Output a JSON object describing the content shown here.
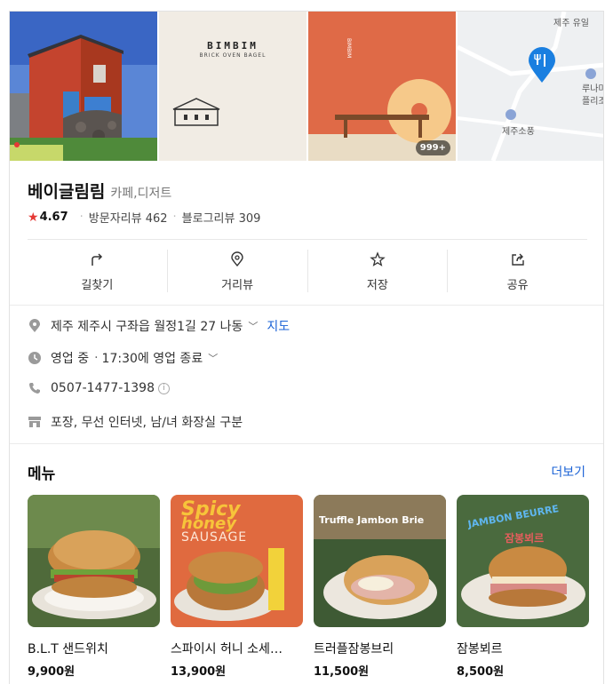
{
  "gallery": {
    "brand_logo": "BIMBIM",
    "brand_sub": "BRICK OVEN BAGEL",
    "photo_count": "999+",
    "map_labels": [
      "제주 유일",
      "루나미",
      "플리조",
      "제주소풍"
    ]
  },
  "place": {
    "name": "베이글림림",
    "category": "카페,디저트",
    "rating": "4.67",
    "visitor_reviews": "방문자리뷰 462",
    "blog_reviews": "블로그리뷰 309"
  },
  "actions": [
    {
      "label": "길찾기",
      "icon": "directions-icon"
    },
    {
      "label": "거리뷰",
      "icon": "map-pin-icon"
    },
    {
      "label": "저장",
      "icon": "star-icon"
    },
    {
      "label": "공유",
      "icon": "share-icon"
    }
  ],
  "info": {
    "address": "제주 제주시 구좌읍 월정1길 27 나동",
    "map_link": "지도",
    "status": "영업 중",
    "hours": "17:30에 영업 종료",
    "phone": "0507-1477-1398",
    "phone_info": "i",
    "amenities": "포장, 무선 인터넷, 남/녀 화장실 구분"
  },
  "menu": {
    "title": "메뉴",
    "more": "더보기",
    "items": [
      {
        "name": "B.L.T 샌드위치",
        "price": "9,900원",
        "overlay": ""
      },
      {
        "name": "스파이시 허니 소세…",
        "price": "13,900원",
        "overlay_line1": "Spicy",
        "overlay_line2": "honey",
        "overlay_line3": "SAUSAGE"
      },
      {
        "name": "트러플잠봉브리",
        "price": "11,500원",
        "overlay_line1": "Truffle Jambon Brie"
      },
      {
        "name": "잠봉뵈르",
        "price": "8,500원",
        "overlay_line1": "JAMBON BEURRE",
        "overlay_line2": "잠봉뵈르"
      }
    ]
  },
  "colors": {
    "accent_link": "#1a62d6",
    "rating_star": "#e53935"
  }
}
